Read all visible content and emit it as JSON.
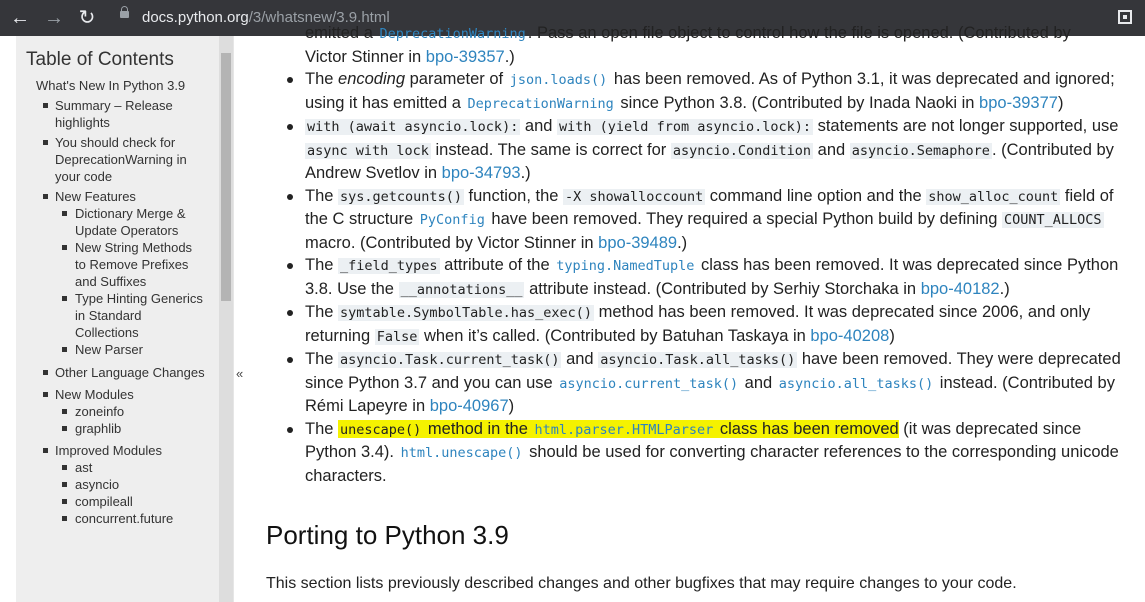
{
  "browser": {
    "url_host": "docs.python.org",
    "url_path": "/3/whatsnew/3.9.html"
  },
  "toc": {
    "title": "Table of Contents",
    "top": "What's New In Python 3.9",
    "items": [
      {
        "label": "Summary – Release highlights"
      },
      {
        "label": "You should check for DeprecationWarning in your code"
      },
      {
        "label": "New Features",
        "children": [
          "Dictionary Merge & Update Operators",
          "New String Methods to Remove Prefixes and Suffixes",
          "Type Hinting Generics in Standard Collections",
          "New Parser"
        ]
      },
      {
        "label": "Other Language Changes"
      },
      {
        "label": "New Modules",
        "children": [
          "zoneinfo",
          "graphlib"
        ]
      },
      {
        "label": "Improved Modules",
        "children": [
          "ast",
          "asyncio",
          "compileall",
          "concurrent.future"
        ]
      }
    ]
  },
  "collapse_glyph": "«",
  "content": {
    "partial_top": {
      "prefix": "emitted a ",
      "code1": "DeprecationWarning",
      "mid": ". Pass an open file object to control how the file is opened. (Contributed by",
      "line2": "Victor Stinner in ",
      "link": "bpo-39357",
      "end": ".)"
    },
    "b1": {
      "a": "The ",
      "em": "encoding",
      "b": " parameter of ",
      "code1": "json.loads()",
      "c": " has been removed. As of Python 3.1, it was deprecated and ignored; using it has emitted a ",
      "code2": "DeprecationWarning",
      "d": " since Python 3.8. (Contributed by Inada Naoki in ",
      "link": "bpo-39377",
      "e": ")"
    },
    "b2": {
      "code1": "with (await asyncio.lock):",
      "a": " and ",
      "code2": "with (yield from asyncio.lock):",
      "b": " statements are not longer supported, use ",
      "code3": "async with lock",
      "c": " instead. The same is correct for ",
      "code4": "asyncio.Condition",
      "d": " and ",
      "code5": "asyncio.Semaphore",
      "e": ". (Contributed by Andrew Svetlov in ",
      "link": "bpo-34793",
      "f": ".)"
    },
    "b3": {
      "a": "The ",
      "code1": "sys.getcounts()",
      "b": " function, the ",
      "code2": "-X showalloccount",
      "c": " command line option and the ",
      "code3": "show_alloc_count",
      "d": " field of the C structure ",
      "code4": "PyConfig",
      "e": " have been removed. They required a special Python build by defining ",
      "code5": "COUNT_ALLOCS",
      "f": " macro. (Contributed by Victor Stinner in ",
      "link": "bpo-39489",
      "g": ".)"
    },
    "b4": {
      "a": "The ",
      "code1": "_field_types",
      "b": " attribute of the ",
      "code2": "typing.NamedTuple",
      "c": " class has been removed. It was deprecated since Python 3.8. Use the ",
      "code3": "__annotations__",
      "d": " attribute instead. (Contributed by Serhiy Storchaka in ",
      "link": "bpo-40182",
      "e": ".)"
    },
    "b5": {
      "a": "The ",
      "code1": "symtable.SymbolTable.has_exec()",
      "b": " method has been removed. It was deprecated since 2006, and only returning ",
      "code2": "False",
      "c": " when it’s called. (Contributed by Batuhan Taskaya in ",
      "link": "bpo-40208",
      "d": ")"
    },
    "b6": {
      "a": "The ",
      "code1": "asyncio.Task.current_task()",
      "b": " and ",
      "code2": "asyncio.Task.all_tasks()",
      "c": " have been removed. They were deprecated since Python 3.7 and you can use ",
      "code3": "asyncio.current_task()",
      "d": " and ",
      "code4": "asyncio.all_tasks()",
      "e": " instead. (Contributed by Rémi Lapeyre in ",
      "link": "bpo-40967",
      "f": ")"
    },
    "b7": {
      "a": "The ",
      "code1": "unescape()",
      "b": " method in the ",
      "code2": "html.parser.HTMLParser",
      "c": " class has been removed",
      "d": " (it was deprecated since Python 3.4). ",
      "code3": "html.unescape()",
      "e": " should be used for converting character references to the corresponding unicode characters."
    },
    "heading": "Porting to Python 3.9",
    "paragraph": "This section lists previously described changes and other bugfixes that may require changes to your code."
  }
}
